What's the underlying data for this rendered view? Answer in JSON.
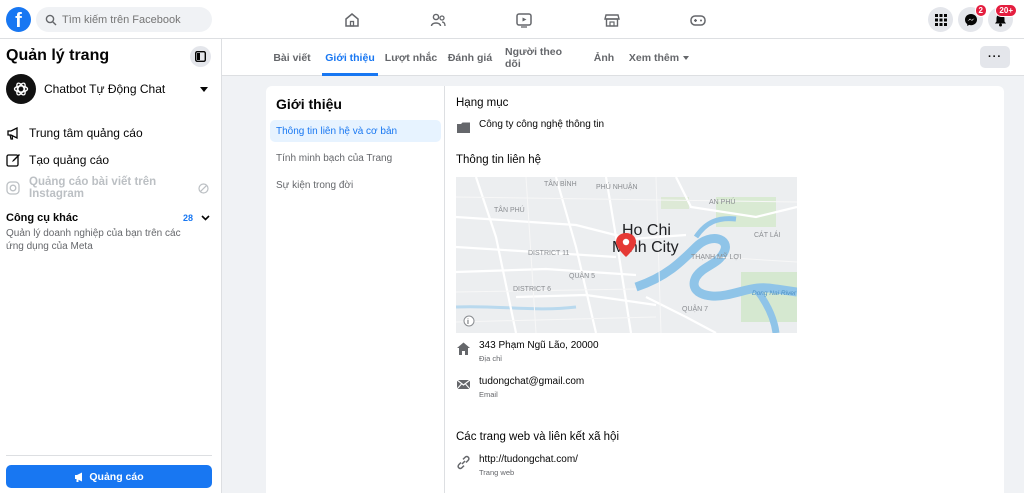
{
  "topbar": {
    "logo": "f",
    "search_placeholder": "Tìm kiếm trên Facebook",
    "nav_icons": [
      "home-icon",
      "friends-icon",
      "watch-icon",
      "marketplace-icon",
      "gaming-icon"
    ],
    "messenger_badge": "2",
    "notifications_badge": "20+"
  },
  "sidebar": {
    "title": "Quản lý trang",
    "page_name": "Chatbot Tự Động Chat",
    "items": [
      {
        "label": "Trung tâm quảng cáo",
        "icon": "megaphone-icon"
      },
      {
        "label": "Tạo quảng cáo",
        "icon": "edit-icon"
      },
      {
        "label": "Quảng cáo bài viết trên Instagram",
        "icon": "instagram-icon"
      }
    ],
    "tools": {
      "label": "Công cụ khác",
      "count": "28",
      "description": "Quản lý doanh nghiệp của bạn trên các ứng dụng của Meta"
    },
    "ads_button": "Quảng cáo"
  },
  "tabs": {
    "items": [
      "Bài viết",
      "Giới thiệu",
      "Lượt nhắc",
      "Đánh giá",
      "Người theo dõi",
      "Ảnh",
      "Xem thêm"
    ],
    "active": "Giới thiệu",
    "more_button": "···"
  },
  "about": {
    "title": "Giới thiệu",
    "nav": [
      "Thông tin liên hệ và cơ bản",
      "Tính minh bạch của Trang",
      "Sự kiện trong đời"
    ],
    "category_title": "Hạng mục",
    "category": "Công ty công nghệ thông tin",
    "contact_title": "Thông tin liên hệ",
    "map": {
      "city_line1": "Ho Chi",
      "city_line2": "Minh City",
      "labels": [
        "TÂN BÌNH",
        "PHÚ NHUẬN",
        "TÂN PHÚ",
        "AN PHÚ",
        "DISTRICT 11",
        "QUẬN 5",
        "DISTRICT 6",
        "QUẬN 7",
        "CÁT LÁI",
        "Dong Nai River",
        "THẠNH MỸ LỢI"
      ]
    },
    "address": "343 Phạm Ngũ Lão, 20000",
    "address_label": "Địa chỉ",
    "email": "tudongchat@gmail.com",
    "email_label": "Email",
    "websites_title": "Các trang web và liên kết xã hội",
    "website": "http://tudongchat.com/",
    "website_label": "Trang web"
  }
}
